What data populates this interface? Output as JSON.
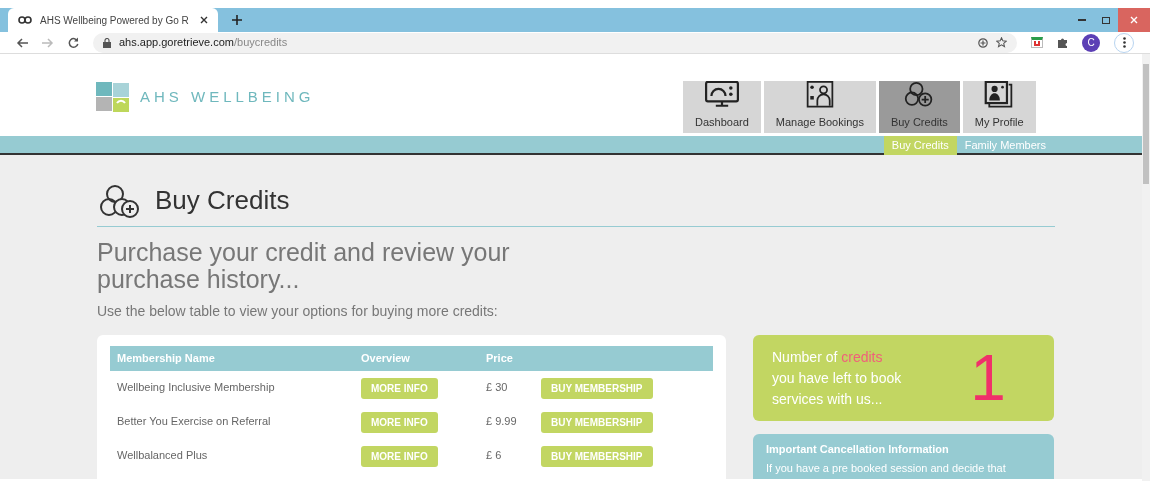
{
  "browser": {
    "tab_title": "AHS Wellbeing Powered by Go R",
    "url_host": "ahs.app.goretrieve.com",
    "url_path": "/buycredits",
    "profile_initial": "C"
  },
  "header": {
    "logo_text": "AHS WELLBEING",
    "nav": [
      {
        "label": "Dashboard",
        "selected": false,
        "kind": "dashboard"
      },
      {
        "label": "Manage Bookings",
        "selected": false,
        "kind": "bookings"
      },
      {
        "label": "Buy Credits",
        "selected": true,
        "kind": "credits"
      },
      {
        "label": "My Profile",
        "selected": false,
        "kind": "profile"
      }
    ],
    "subnav": [
      {
        "label": "Buy Credits",
        "selected": true
      },
      {
        "label": "Family Members",
        "selected": false
      }
    ]
  },
  "page": {
    "title": "Buy Credits",
    "headline": "Purchase your credit and review your purchase history...",
    "intro": "Use the below table to view your options for buying more credits:"
  },
  "table": {
    "columns": [
      "Membership Name",
      "Overview",
      "Price"
    ],
    "rows": [
      {
        "name": "Wellbeing Inclusive Membership",
        "overview_button": "MORE INFO",
        "price": "£ 30",
        "buy_button": "BUY MEMBERSHIP"
      },
      {
        "name": "Better You Exercise on Referral",
        "overview_button": "MORE INFO",
        "price": "£ 9.99",
        "buy_button": "BUY MEMBERSHIP"
      },
      {
        "name": "Wellbalanced Plus",
        "overview_button": "MORE INFO",
        "price": "£ 6",
        "buy_button": "BUY MEMBERSHIP"
      }
    ]
  },
  "credits_card": {
    "text_before": "Number of",
    "highlight": "credits",
    "text_after": "you have left to book services with us...",
    "count": "1"
  },
  "cancellation_card": {
    "title": "Important Cancellation Information",
    "text": "If you have a pre booked session and decide that"
  }
}
